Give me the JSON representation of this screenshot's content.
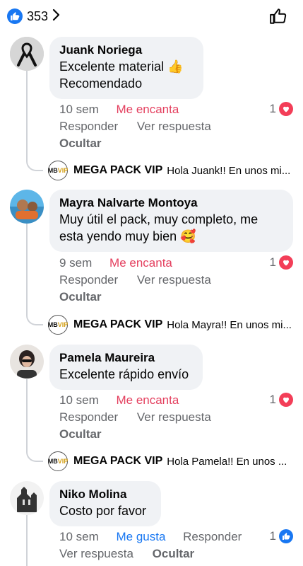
{
  "header": {
    "like_count": "353"
  },
  "comments": [
    {
      "name": "Juank Noriega",
      "lines": [
        "Excelente material 👍",
        "Recomendado"
      ],
      "time": "10 sem",
      "reaction": "Me encanta",
      "reaction_count": "1",
      "reply_label": "Responder",
      "view_reply_label": "Ver respuesta",
      "hide_label": "Ocultar",
      "reply": {
        "name": "MEGA PACK VIP",
        "preview": "Hola Juank!! En unos mi..."
      }
    },
    {
      "name": "Mayra Nalvarte Montoya",
      "lines": [
        "Muy útil el pack, muy completo, me",
        "esta yendo muy bien 🥰"
      ],
      "time": "9 sem",
      "reaction": "Me encanta",
      "reaction_count": "1",
      "reply_label": "Responder",
      "view_reply_label": "Ver respuesta",
      "hide_label": "Ocultar",
      "reply": {
        "name": "MEGA PACK VIP",
        "preview": "Hola Mayra!! En unos mi..."
      }
    },
    {
      "name": "Pamela Maureira",
      "lines": [
        "Excelente rápido envío"
      ],
      "time": "10 sem",
      "reaction": "Me encanta",
      "reaction_count": "1",
      "reply_label": "Responder",
      "view_reply_label": "Ver respuesta",
      "hide_label": "Ocultar",
      "reply": {
        "name": "MEGA PACK VIP",
        "preview": "Hola Pamela!! En unos ..."
      }
    },
    {
      "name": "Niko Molina",
      "lines": [
        "Costo por favor"
      ],
      "time": "10 sem",
      "reaction": "Me gusta",
      "reaction_count": "1",
      "reply_label": "Responder",
      "view_reply_label": "Ver respuesta",
      "hide_label": "Ocultar"
    }
  ],
  "logo": {
    "left": "MB",
    "right": "VIP"
  },
  "colors": {
    "love": "#e4405f",
    "like": "#1877f2",
    "bubble": "#f0f2f5",
    "muted": "#65676b"
  }
}
